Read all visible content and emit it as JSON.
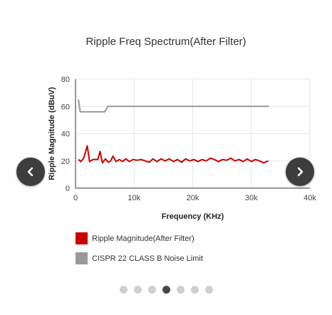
{
  "chart_data": {
    "type": "line",
    "title": "Ripple Freq Spectrum(After Filter)",
    "xlabel": "Frequency (KHz)",
    "ylabel": "Ripple Magnitude (dBuV)",
    "xlim": [
      0,
      40000
    ],
    "ylim": [
      0,
      80
    ],
    "x_ticks": [
      {
        "value": 0,
        "label": "0"
      },
      {
        "value": 10000,
        "label": "10k"
      },
      {
        "value": 20000,
        "label": "20k"
      },
      {
        "value": 30000,
        "label": "30k"
      },
      {
        "value": 40000,
        "label": "40k"
      }
    ],
    "y_ticks": [
      {
        "value": 0,
        "label": "0"
      },
      {
        "value": 20,
        "label": "20"
      },
      {
        "value": 40,
        "label": "40"
      },
      {
        "value": 60,
        "label": "60"
      },
      {
        "value": 80,
        "label": "80"
      }
    ],
    "grid": true,
    "legend_position": "bottom-left",
    "series": [
      {
        "name": "Ripple Magnitude(After Filter)",
        "color": "#cc0000",
        "points": [
          [
            500,
            21
          ],
          [
            900,
            19.5
          ],
          [
            1400,
            22
          ],
          [
            2000,
            31
          ],
          [
            2400,
            19.5
          ],
          [
            3000,
            21
          ],
          [
            3800,
            21
          ],
          [
            4200,
            27
          ],
          [
            4600,
            18.5
          ],
          [
            5100,
            21.5
          ],
          [
            5600,
            19
          ],
          [
            6000,
            20
          ],
          [
            6400,
            23.5
          ],
          [
            6900,
            19.5
          ],
          [
            7500,
            21
          ],
          [
            8000,
            19.5
          ],
          [
            8600,
            21.5
          ],
          [
            9200,
            19.5
          ],
          [
            9800,
            21
          ],
          [
            10500,
            20.5
          ],
          [
            11200,
            21
          ],
          [
            11900,
            20
          ],
          [
            12600,
            19
          ],
          [
            13200,
            21.5
          ],
          [
            13900,
            19.5
          ],
          [
            14600,
            21.5
          ],
          [
            15300,
            20
          ],
          [
            16000,
            21.5
          ],
          [
            16700,
            19.5
          ],
          [
            17400,
            21
          ],
          [
            18100,
            19
          ],
          [
            18800,
            21.5
          ],
          [
            19500,
            20
          ],
          [
            20200,
            21
          ],
          [
            20900,
            19.5
          ],
          [
            21600,
            21
          ],
          [
            22300,
            20
          ],
          [
            23000,
            22
          ],
          [
            23700,
            21
          ],
          [
            24400,
            19.5
          ],
          [
            25100,
            21
          ],
          [
            25800,
            20.5
          ],
          [
            26500,
            22
          ],
          [
            27200,
            20
          ],
          [
            27900,
            21
          ],
          [
            28600,
            19.5
          ],
          [
            29300,
            21.5
          ],
          [
            30000,
            19.5
          ],
          [
            30700,
            21
          ],
          [
            31400,
            20
          ],
          [
            32100,
            18.5
          ],
          [
            32900,
            20
          ]
        ]
      },
      {
        "name": "CISPR 22 CLASS B Noise Limit",
        "color": "#999999",
        "points": [
          [
            500,
            65
          ],
          [
            800,
            56
          ],
          [
            5000,
            56
          ],
          [
            5500,
            60
          ],
          [
            33000,
            60
          ]
        ]
      }
    ]
  },
  "navigation": {
    "prev_icon": "chevron-left-icon",
    "next_icon": "chevron-right-icon"
  },
  "carousel": {
    "total": 7,
    "active_index": 3
  }
}
